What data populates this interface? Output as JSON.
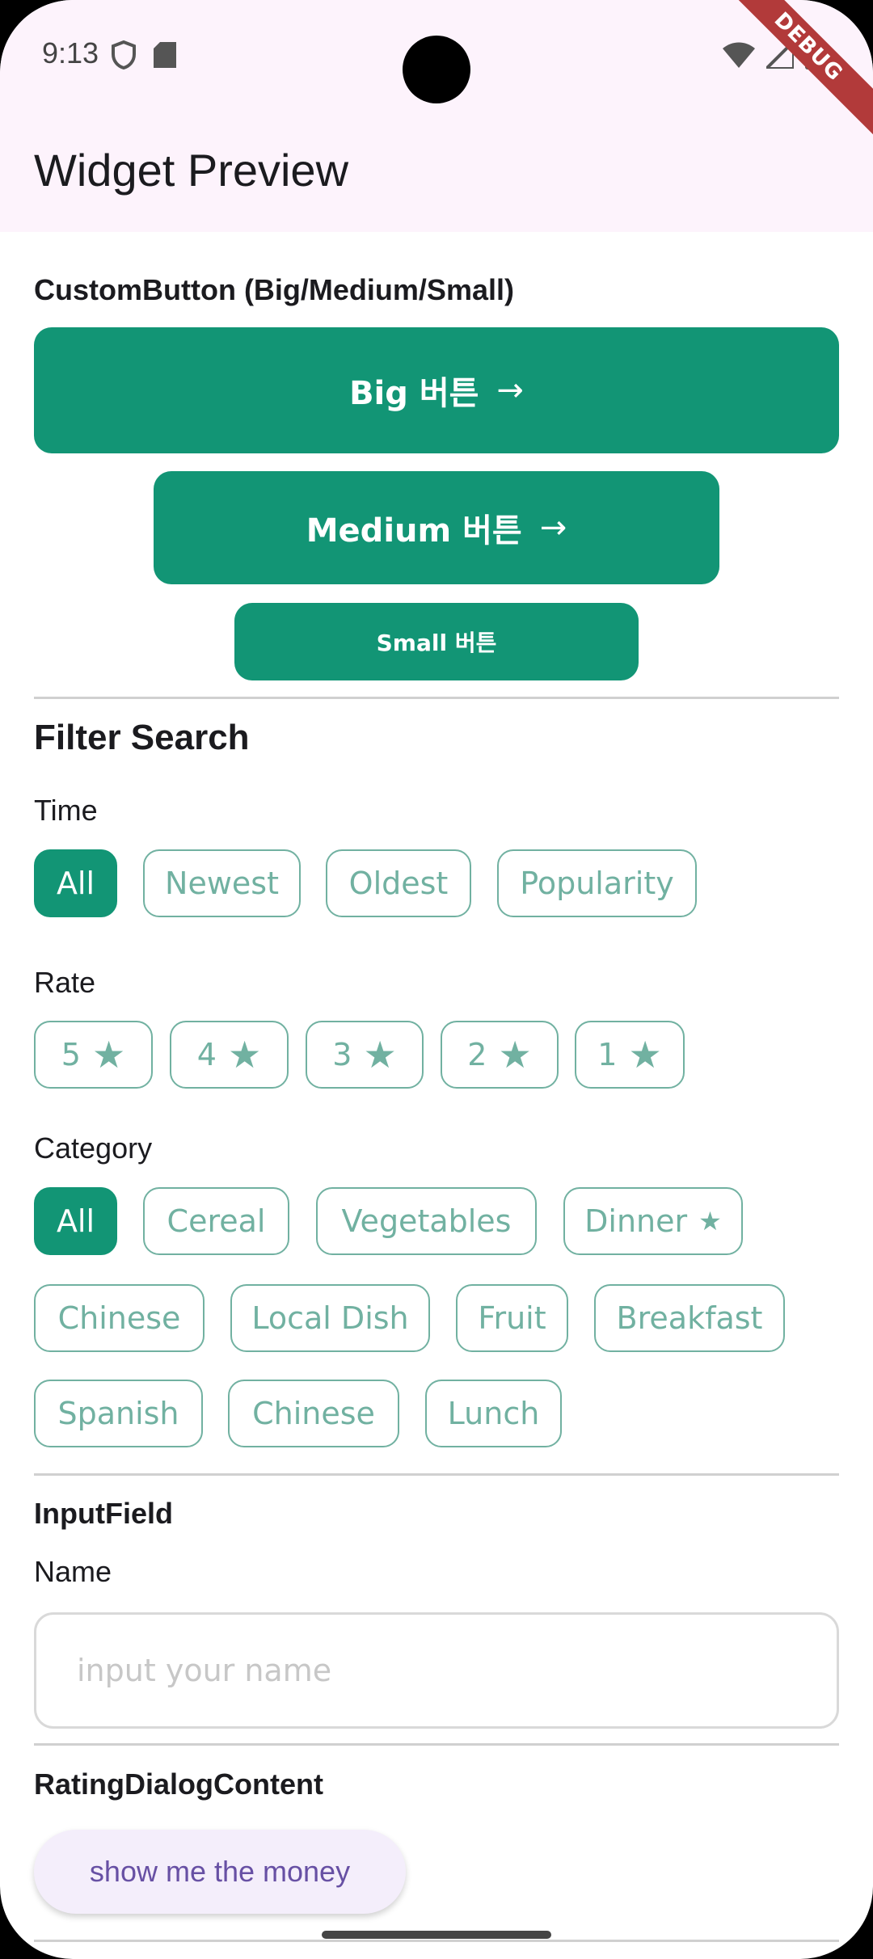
{
  "status_bar": {
    "time": "9:13"
  },
  "debug_banner": "DEBUG",
  "app_bar": {
    "title": "Widget Preview"
  },
  "custom_button": {
    "section_title": "CustomButton (Big/Medium/Small)",
    "big": "Big 버튼",
    "medium": "Medium 버튼",
    "small": "Small 버튼",
    "arrow": "→"
  },
  "filter": {
    "title": "Filter Search",
    "time_label": "Time",
    "time_chips": [
      "All",
      "Newest",
      "Oldest",
      "Popularity"
    ],
    "rate_label": "Rate",
    "rate_chips": [
      "5",
      "4",
      "3",
      "2",
      "1"
    ],
    "category_label": "Category",
    "category_chips": [
      "All",
      "Cereal",
      "Vegetables",
      "Dinner",
      "Chinese",
      "Local Dish",
      "Fruit",
      "Breakfast",
      "Spanish",
      "Chinese",
      "Lunch"
    ]
  },
  "input_field": {
    "section_title": "InputField",
    "label": "Name",
    "placeholder": "input your name"
  },
  "rating_dialog": {
    "section_title": "RatingDialogContent",
    "button": "show me the money"
  },
  "colors": {
    "primary": "#129575",
    "chip_outline": "#71b1a1",
    "appbar_bg": "#fdf3fc"
  }
}
